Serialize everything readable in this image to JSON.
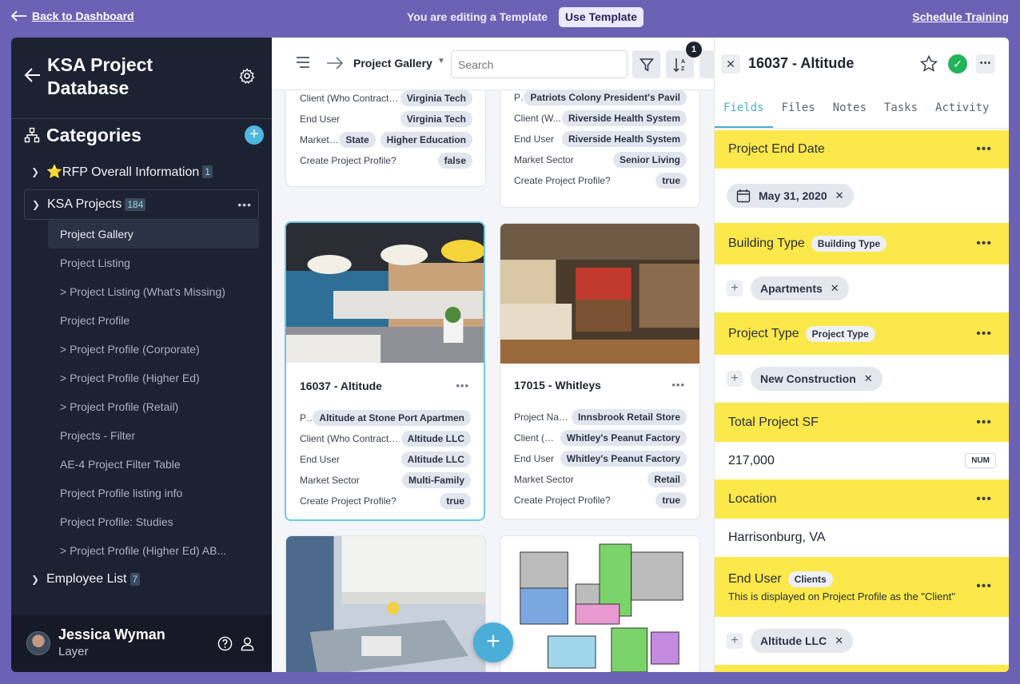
{
  "banner": {
    "back_label": "Back to Dashboard",
    "editing_text": "You are editing a Template",
    "use_template_label": "Use Template",
    "schedule_training_label": "Schedule Training"
  },
  "sidebar": {
    "title": "KSA Project Database",
    "categories_label": "Categories",
    "tree": {
      "rfp": {
        "label": "⭐RFP Overall Information",
        "count": "1"
      },
      "ksa": {
        "label": "KSA Projects",
        "count": "184"
      },
      "children": [
        "Project Gallery",
        "Project Listing",
        "> Project Listing (What's Missing)",
        "Project Profile",
        "> Project Profile (Corporate)",
        "> Project Profile (Higher Ed)",
        "> Project Profile (Retail)",
        "Projects - Filter",
        "AE-4 Project Filter Table",
        "Project Profile listing info",
        "Project Profile: Studies",
        "> Project Profile (Higher Ed) AB..."
      ],
      "employee": {
        "label": "Employee List",
        "count": "7"
      }
    },
    "user": {
      "name": "Jessica Wyman",
      "org": "Layer"
    }
  },
  "toolbar": {
    "view_title": "Project Gallery",
    "search_placeholder": "Search",
    "sort_badge": "1"
  },
  "cards": {
    "top_left": {
      "rows": [
        {
          "key": "Client (Who Contracte...",
          "values": [
            "Virginia Tech"
          ]
        },
        {
          "key": "End User",
          "values": [
            "Virginia Tech"
          ]
        },
        {
          "key": "Market ...",
          "values": [
            "State",
            "Higher Education"
          ]
        },
        {
          "key": "Create Project Profile?",
          "values": [
            "false"
          ]
        }
      ]
    },
    "top_right": {
      "rows": [
        {
          "key": "Projec...",
          "values": [
            "Patriots Colony President's Pavil"
          ]
        },
        {
          "key": "Client (W...",
          "values": [
            "Riverside Health System"
          ]
        },
        {
          "key": "End User",
          "values": [
            "Riverside Health System"
          ]
        },
        {
          "key": "Market Sector",
          "values": [
            "Senior Living"
          ]
        },
        {
          "key": "Create Project Profile?",
          "values": [
            "true"
          ]
        }
      ]
    },
    "altitude": {
      "name": "16037 - Altitude",
      "rows": [
        {
          "key": "Projec...",
          "values": [
            "Altitude at Stone Port Apartmen"
          ]
        },
        {
          "key": "Client (Who Contracte...",
          "values": [
            "Altitude LLC"
          ]
        },
        {
          "key": "End User",
          "values": [
            "Altitude LLC"
          ]
        },
        {
          "key": "Market Sector",
          "values": [
            "Multi-Family"
          ]
        },
        {
          "key": "Create Project Profile?",
          "values": [
            "true"
          ]
        }
      ]
    },
    "whitleys": {
      "name": "17015 - Whitleys",
      "rows": [
        {
          "key": "Project Name",
          "values": [
            "Innsbrook Retail Store"
          ]
        },
        {
          "key": "Client (W...",
          "values": [
            "Whitley's Peanut Factory"
          ]
        },
        {
          "key": "End User",
          "values": [
            "Whitley's Peanut Factory"
          ]
        },
        {
          "key": "Market Sector",
          "values": [
            "Retail"
          ]
        },
        {
          "key": "Create Project Profile?",
          "values": [
            "true"
          ]
        }
      ]
    }
  },
  "detail": {
    "title": "16037 - Altitude",
    "tabs": [
      "Fields",
      "Files",
      "Notes",
      "Tasks",
      "Activity"
    ],
    "fields": {
      "end_date": {
        "label": "Project End Date",
        "value": "May 31, 2020"
      },
      "building_type": {
        "label": "Building Type",
        "tag": "Building Type",
        "value": "Apartments"
      },
      "project_type": {
        "label": "Project Type",
        "tag": "Project Type",
        "value": "New Construction"
      },
      "total_sf": {
        "label": "Total Project SF",
        "value": "217,000",
        "type_badge": "NUM"
      },
      "location": {
        "label": "Location",
        "value": "Harrisonburg, VA"
      },
      "end_user": {
        "label": "End User",
        "tag": "Clients",
        "description": "This is displayed on Project Profile as the \"Client\"",
        "value": "Altitude LLC"
      }
    }
  },
  "icons": [
    "arrow-left-icon",
    "gear-icon",
    "hierarchy-icon",
    "plus-icon",
    "chevron-right-icon",
    "chevron-down-icon",
    "more-icon",
    "menu-icon",
    "arrow-right-icon",
    "filter-icon",
    "sort-icon",
    "close-icon",
    "star-icon",
    "check-icon",
    "calendar-icon",
    "help-icon",
    "user-icon"
  ],
  "colors": {
    "accent": "#4aaed8",
    "banner": "#6b62b5",
    "sidebar": "#1d2232",
    "field_header": "#fbe84b",
    "done": "#22b35b"
  }
}
